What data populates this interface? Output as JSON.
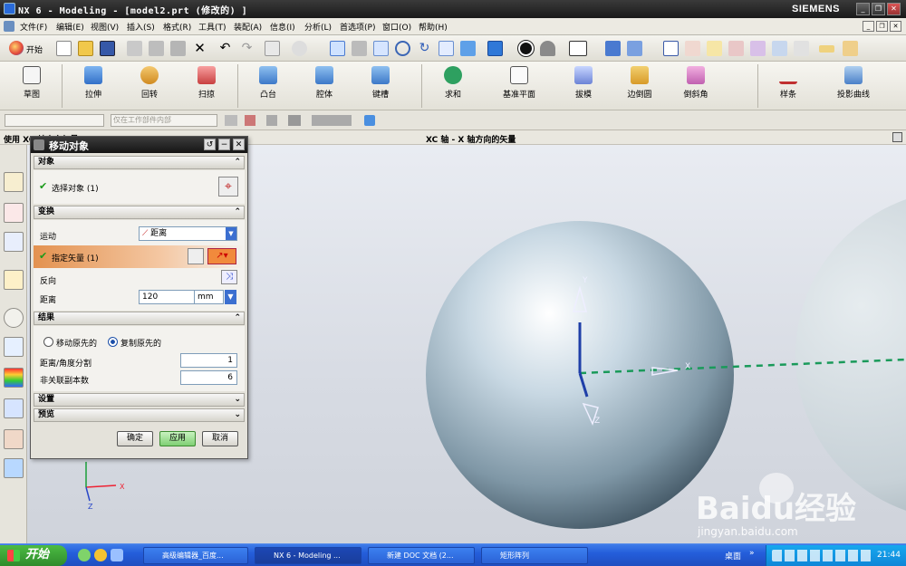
{
  "window": {
    "title": "NX 6 - Modeling - [model2.prt  (修改的) ]",
    "brand": "SIEMENS",
    "controls": [
      "_",
      "❐",
      "✕"
    ]
  },
  "menubar": {
    "items": [
      "文件(F)",
      "编辑(E)",
      "视图(V)",
      "插入(S)",
      "格式(R)",
      "工具(T)",
      "装配(A)",
      "信息(I)",
      "分析(L)",
      "首选项(P)",
      "窗口(O)",
      "帮助(H)"
    ],
    "start": "开始"
  },
  "feature_toolbar": {
    "items": [
      "草图",
      "拉伸",
      "回转",
      "扫掠",
      "凸台",
      "腔体",
      "键槽",
      "求和",
      "基准平面",
      "拔模",
      "边倒圆",
      "倒斜角",
      "样条",
      "投影曲线"
    ]
  },
  "filter_bar": {
    "type_filter": "",
    "scope_filter": "仅在工作部件内部"
  },
  "cue_line": {
    "left": "使用 XC 轴方向矢量",
    "center": "XC 轴 - X 轴方向的矢量"
  },
  "dialog": {
    "title": "移动对象",
    "object_group": "对象",
    "select_object": "选择对象 (1)",
    "transform_group": "变换",
    "motion_label": "运动",
    "motion_value": "距离",
    "vector_label": "指定矢量 (1)",
    "reverse_label": "反向",
    "distance_label": "距离",
    "distance_value": "120",
    "distance_unit": "mm",
    "result_group": "结果",
    "move_original": "移动原先的",
    "copy_original": "复制原先的",
    "copy_selected": true,
    "divisions_label": "距离/角度分割",
    "divisions_value": "1",
    "copies_label": "非关联副本数",
    "copies_value": "6",
    "settings_group": "设置",
    "preview_group": "预览",
    "ok": "确定",
    "apply": "应用",
    "cancel": "取消"
  },
  "viewport": {
    "axis_labels": {
      "x": "X",
      "y": "Y",
      "z": "Z"
    },
    "handle_labels": {
      "x": "X",
      "y": "Y",
      "z": "Z"
    },
    "watermark_brand": "Baidu经验",
    "watermark_url": "jingyan.baidu.com"
  },
  "taskbar": {
    "start": "开始",
    "tasks": [
      "高级编辑器_百度...",
      "NX 6 - Modeling ...",
      "新建 DOC 文档 (2...",
      "矩形阵列"
    ],
    "desktop": "桌面",
    "clock": "21:44"
  },
  "colors": {
    "accent_vector_row": "#e8a060",
    "title_bar": "#222222",
    "taskbar": "#245edb",
    "sphere": "#b8c8d4"
  }
}
